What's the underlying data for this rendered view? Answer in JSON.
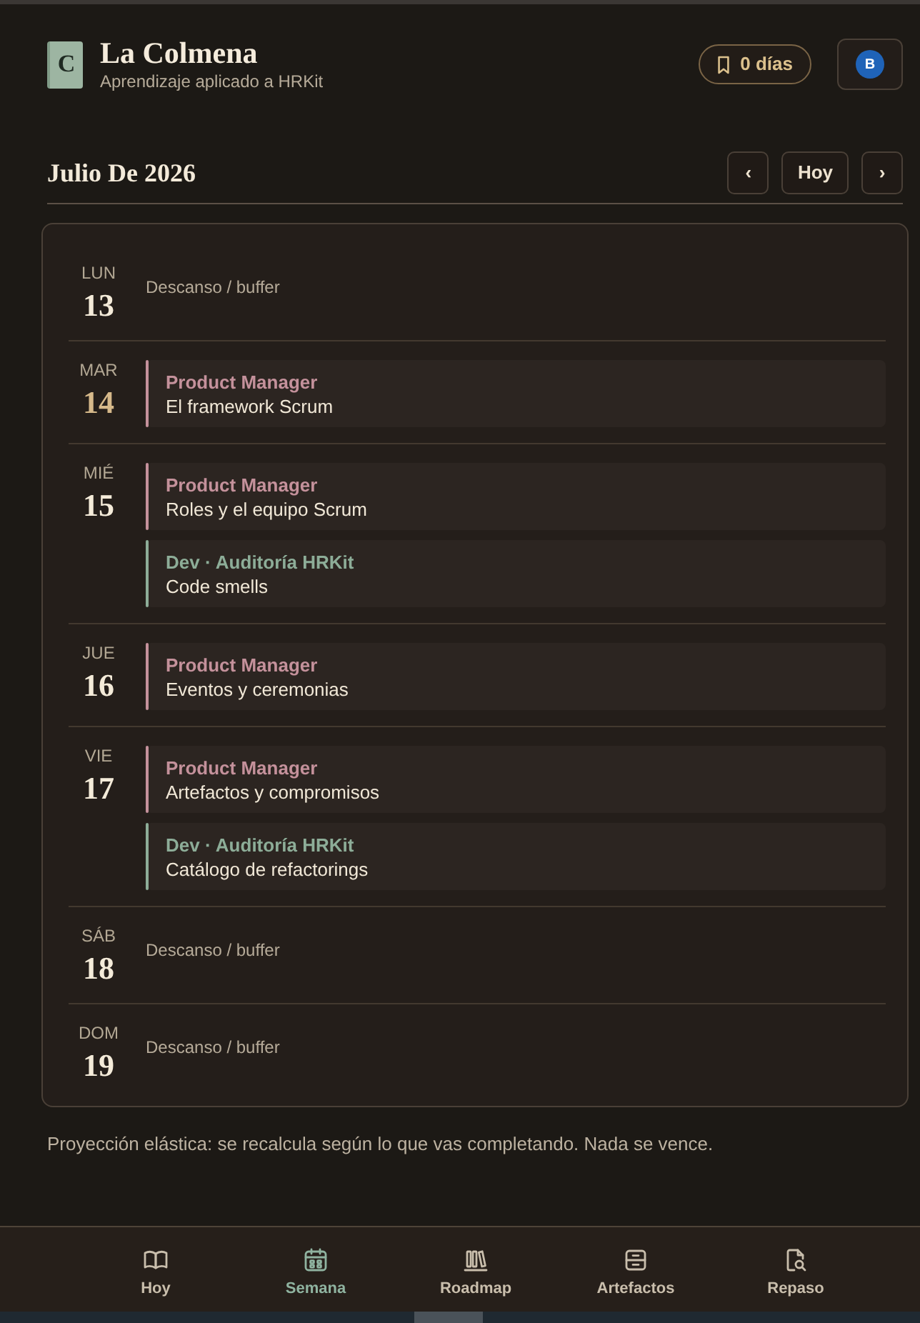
{
  "header": {
    "logo_letter": "C",
    "title": "La Colmena",
    "subtitle": "Aprendizaje aplicado a HRKit",
    "streak": "0 días",
    "avatar": "B"
  },
  "week": {
    "title": "Julio De 2026",
    "prev": "‹",
    "today_button": "Hoy",
    "next": "›"
  },
  "days": [
    {
      "weekday": "LUN",
      "day": "13",
      "today": false,
      "note": "Descanso / buffer"
    },
    {
      "weekday": "MAR",
      "day": "14",
      "today": true,
      "tasks": [
        {
          "track": "Product Manager",
          "title": "El framework Scrum",
          "color": "#c4919b"
        }
      ]
    },
    {
      "weekday": "MIÉ",
      "day": "15",
      "today": false,
      "tasks": [
        {
          "track": "Product Manager",
          "title": "Roles y el equipo Scrum",
          "color": "#c4919b"
        },
        {
          "track": "Dev · Auditoría HRKit",
          "title": "Code smells",
          "color": "#8dad98"
        }
      ]
    },
    {
      "weekday": "JUE",
      "day": "16",
      "today": false,
      "tasks": [
        {
          "track": "Product Manager",
          "title": "Eventos y ceremonias",
          "color": "#c4919b"
        }
      ]
    },
    {
      "weekday": "VIE",
      "day": "17",
      "today": false,
      "tasks": [
        {
          "track": "Product Manager",
          "title": "Artefactos y compromisos",
          "color": "#c4919b"
        },
        {
          "track": "Dev · Auditoría HRKit",
          "title": "Catálogo de refactorings",
          "color": "#8dad98"
        }
      ]
    },
    {
      "weekday": "SÁB",
      "day": "18",
      "today": false,
      "note": "Descanso / buffer"
    },
    {
      "weekday": "DOM",
      "day": "19",
      "today": false,
      "note": "Descanso / buffer"
    }
  ],
  "footnote": "Proyección elástica: se recalcula según lo que vas completando. Nada se vence.",
  "bottom_nav": [
    {
      "label": "Hoy",
      "selected": false
    },
    {
      "label": "Semana",
      "selected": true
    },
    {
      "label": "Roadmap",
      "selected": false
    },
    {
      "label": "Artefactos",
      "selected": false
    },
    {
      "label": "Repaso",
      "selected": false
    }
  ]
}
